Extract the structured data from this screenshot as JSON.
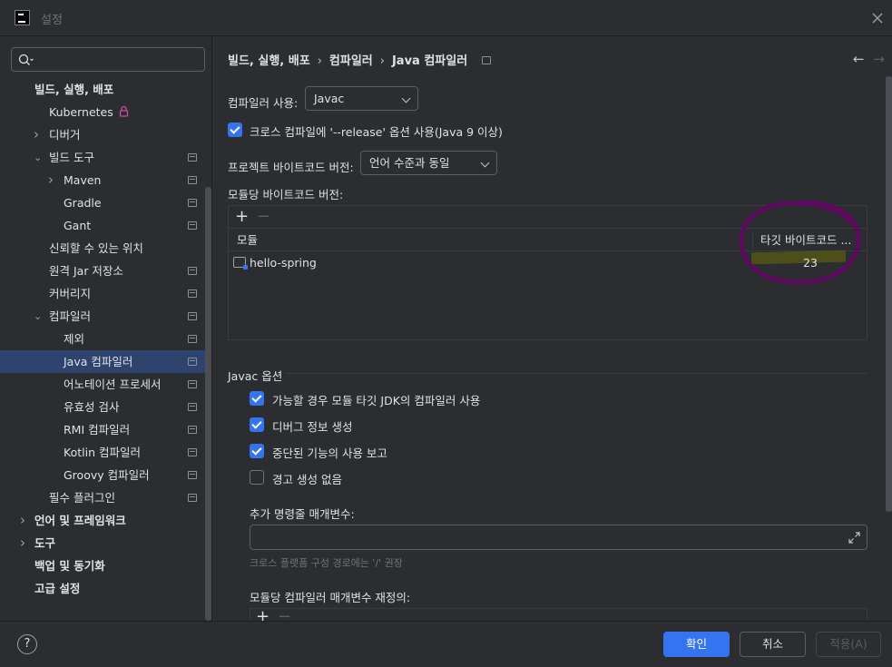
{
  "window": {
    "title": "설정"
  },
  "search": {
    "placeholder": ""
  },
  "sidebar": {
    "items": [
      {
        "label": "빌드, 실행, 배포",
        "bold": true,
        "level": 0
      },
      {
        "label": "Kubernetes",
        "level": 1,
        "locked": true
      },
      {
        "label": "디버거",
        "level": 1,
        "expandable": "collapsed"
      },
      {
        "label": "빌드 도구",
        "level": 1,
        "expandable": "expanded",
        "settings": true
      },
      {
        "label": "Maven",
        "level": 2,
        "expandable": "collapsed",
        "settings": true
      },
      {
        "label": "Gradle",
        "level": 2,
        "settings": true
      },
      {
        "label": "Gant",
        "level": 2,
        "settings": true
      },
      {
        "label": "신뢰할 수 있는 위치",
        "level": 1
      },
      {
        "label": "원격 Jar 저장소",
        "level": 1,
        "settings": true
      },
      {
        "label": "커버리지",
        "level": 1,
        "settings": true
      },
      {
        "label": "컴파일러",
        "level": 1,
        "expandable": "expanded",
        "settings": true
      },
      {
        "label": "제외",
        "level": 2,
        "settings": true
      },
      {
        "label": "Java 컴파일러",
        "level": 2,
        "settings": true,
        "selected": true
      },
      {
        "label": "어노테이션 프로세서",
        "level": 2,
        "settings": true
      },
      {
        "label": "유효성 검사",
        "level": 2,
        "settings": true
      },
      {
        "label": "RMI 컴파일러",
        "level": 2,
        "settings": true
      },
      {
        "label": "Kotlin 컴파일러",
        "level": 2,
        "settings": true
      },
      {
        "label": "Groovy 컴파일러",
        "level": 2,
        "settings": true
      },
      {
        "label": "필수 플러그인",
        "level": 1,
        "settings": true
      },
      {
        "label": "언어 및 프레임워크",
        "bold": true,
        "level": 0,
        "expandable": "collapsed"
      },
      {
        "label": "도구",
        "bold": true,
        "level": 0,
        "expandable": "collapsed"
      },
      {
        "label": "백업 및 동기화",
        "bold": true,
        "level": 0
      },
      {
        "label": "고급 설정",
        "bold": true,
        "level": 0
      }
    ]
  },
  "breadcrumb": [
    "빌드, 실행, 배포",
    "컴파일러",
    "Java 컴파일러"
  ],
  "compiler": {
    "use_label": "컴파일러 사용:",
    "use_value": "Javac",
    "cross_compile_label": "크로스 컴파일에 '--release' 옵션 사용(Java 9 이상)",
    "cross_compile_checked": true,
    "project_bytecode_label": "프로젝트 바이트코드 버전:",
    "project_bytecode_value": "언어 수준과 동일",
    "module_bytecode_label": "모듈당 바이트코드 버전:"
  },
  "module_table": {
    "columns": [
      "모듈",
      "타깃 바이트코드 ..."
    ],
    "rows": [
      {
        "module": "hello-spring",
        "target": "23"
      }
    ]
  },
  "javac": {
    "section_title": "Javac 옵션",
    "options": [
      {
        "label": "가능할 경우 모듈 타깃 JDK의 컴파일러 사용",
        "checked": true
      },
      {
        "label": "디버그 정보 생성",
        "checked": true
      },
      {
        "label": "중단된 기능의 사용 보고",
        "checked": true
      },
      {
        "label": "경고 생성 없음",
        "checked": false
      }
    ],
    "extra_params_label": "추가 명령줄 매개변수:",
    "extra_params_value": "",
    "hint": "크로스 플랫폼 구성 경로에는 '/' 권장",
    "override_label": "모듈당 컴파일러 매개변수 재정의:"
  },
  "footer": {
    "help": "?",
    "ok": "확인",
    "cancel": "취소",
    "apply": "적용(A)"
  },
  "colors": {
    "accent": "#3574f0",
    "annotation": "#5b0a5e",
    "highlight": "#5a5a12"
  }
}
